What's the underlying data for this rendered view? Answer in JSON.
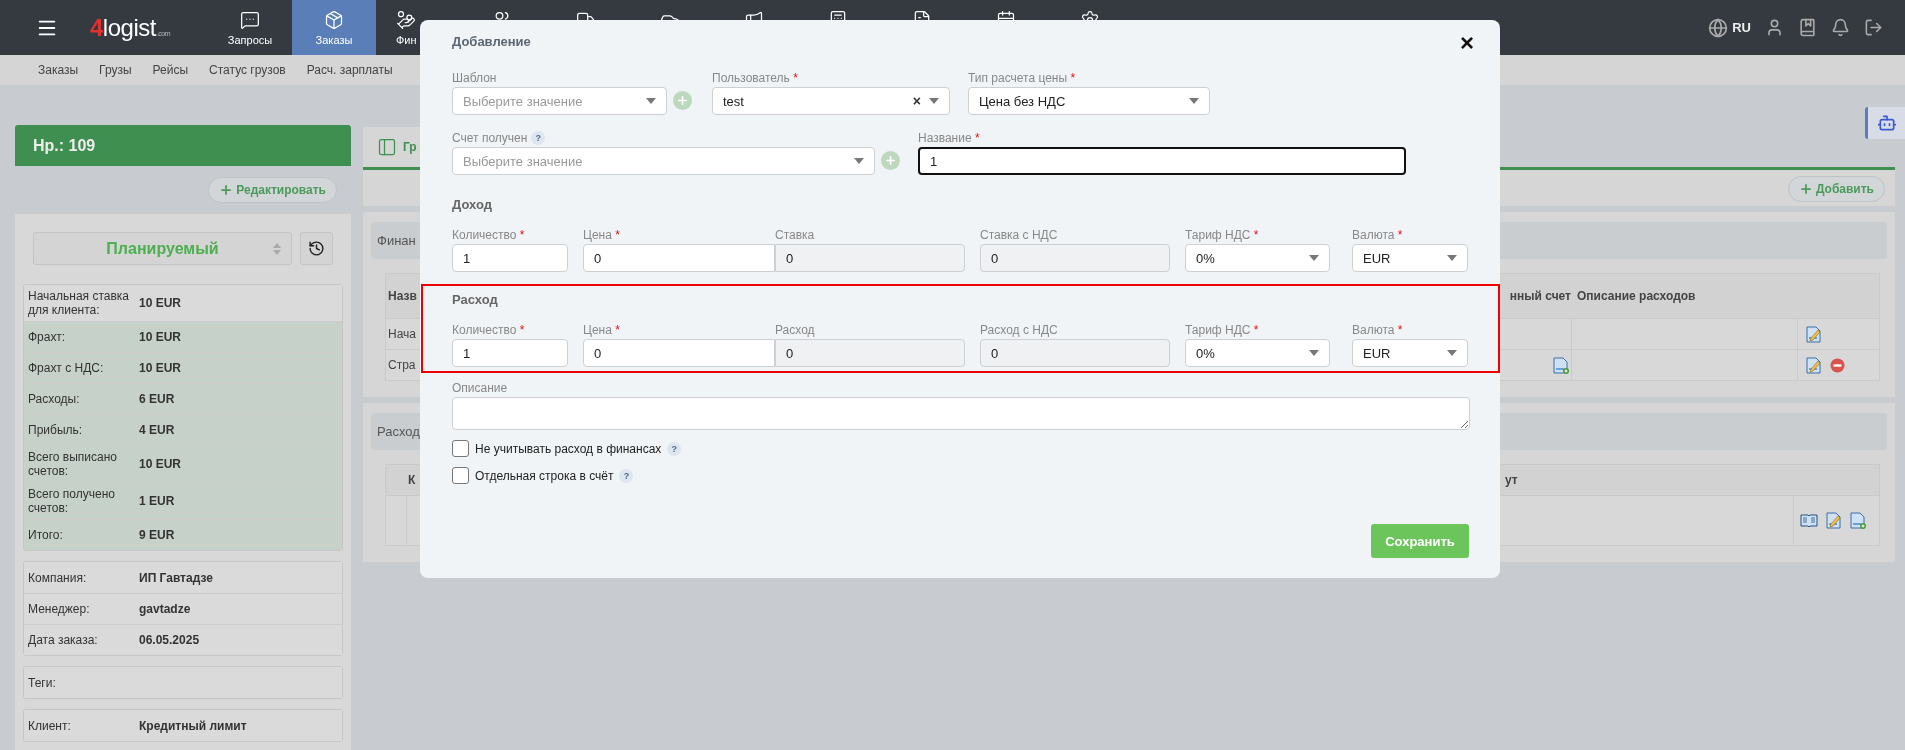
{
  "topbar": {
    "logo": {
      "mark": "4",
      "name": "logist",
      "domain": ".com"
    },
    "nav": [
      {
        "label": "Запросы",
        "selected": false
      },
      {
        "label": "Заказы",
        "selected": true
      },
      {
        "label": "Фин",
        "selected": false
      }
    ],
    "language": "RU"
  },
  "subnav": [
    "Заказы",
    "Грузы",
    "Рейсы",
    "Статус грузов",
    "Расч. зарплаты"
  ],
  "order": {
    "title": "Нр.: 109",
    "edit_button": "Редактировать",
    "status": "Планируемый",
    "summary": [
      {
        "label": "Начальная ставка для клиента:",
        "value": "10 EUR",
        "highlighted": false
      },
      {
        "label": "Фрахт:",
        "value": "10 EUR",
        "highlighted": true
      },
      {
        "label": "Фрахт с НДС:",
        "value": "10 EUR",
        "highlighted": true
      },
      {
        "label": "Расходы:",
        "value": "6 EUR",
        "highlighted": true
      },
      {
        "label": "Прибыль:",
        "value": "4 EUR",
        "highlighted": true
      },
      {
        "label": "Всего выписано счетов:",
        "value": "10 EUR",
        "highlighted": true
      },
      {
        "label": "Всего получено счетов:",
        "value": "1 EUR",
        "highlighted": true
      },
      {
        "label": "Итого:",
        "value": "9 EUR",
        "highlighted": true
      }
    ],
    "details": [
      {
        "label": "Компания:",
        "value": "ИП Гавтадзе"
      },
      {
        "label": "Менеджер:",
        "value": "gavtadze"
      },
      {
        "label": "Дата заказа:",
        "value": "06.05.2025"
      }
    ],
    "tags": {
      "label": "Теги:"
    },
    "client": {
      "label": "Клиент:",
      "value": "Кредитный лимит"
    }
  },
  "main": {
    "tab_label": "Гр",
    "add_button": "Добавить",
    "finance": {
      "title": "Финан",
      "columns": [
        "Назв",
        "нный счет",
        "Описание расходов"
      ],
      "rows": [
        {
          "name": "Нача",
          "has_document": false,
          "removable": false
        },
        {
          "name": "Стра",
          "has_document": true,
          "removable": true
        }
      ]
    },
    "expenses": {
      "title": "Расход",
      "columns": [
        "К",
        "ут"
      ]
    }
  },
  "modal": {
    "title": "Добавление",
    "close": "×",
    "required_mark": "*",
    "help_mark": "?",
    "row1": [
      {
        "label": "Шаблон",
        "required": false,
        "kind": "select",
        "placeholder": "Выберите значение",
        "addable": true
      },
      {
        "label": "Пользователь",
        "required": true,
        "kind": "clearable",
        "value": "test",
        "clear": "×"
      },
      {
        "label": "Тип расчета цены",
        "required": true,
        "kind": "select",
        "value": "Цена без НДС"
      }
    ],
    "row2": [
      {
        "label": "Счет получен",
        "required": false,
        "help": true,
        "kind": "select",
        "placeholder": "Выберите значение",
        "addable": true
      },
      {
        "label": "Название",
        "required": true,
        "kind": "text",
        "value": "1",
        "focused": true
      }
    ],
    "income": {
      "title": "Доход",
      "highlighted": false,
      "fields": [
        {
          "label": "Количество",
          "required": true,
          "kind": "text",
          "value": "1"
        },
        {
          "label": "Цена",
          "required": true,
          "kind": "text",
          "value": "0"
        },
        {
          "label": "Ставка",
          "required": false,
          "kind": "readonly",
          "value": "0"
        },
        {
          "label": "Ставка с НДС",
          "required": false,
          "kind": "readonly",
          "value": "0"
        },
        {
          "label": "Тариф НДС",
          "required": true,
          "kind": "select",
          "value": "0%"
        },
        {
          "label": "Валюта",
          "required": true,
          "kind": "select",
          "value": "EUR"
        }
      ]
    },
    "expense": {
      "title": "Расход",
      "highlighted": true,
      "fields": [
        {
          "label": "Количество",
          "required": true,
          "kind": "text",
          "value": "1"
        },
        {
          "label": "Цена",
          "required": true,
          "kind": "text",
          "value": "0"
        },
        {
          "label": "Расход",
          "required": false,
          "kind": "readonly",
          "value": "0"
        },
        {
          "label": "Расход с НДС",
          "required": false,
          "kind": "readonly",
          "value": "0"
        },
        {
          "label": "Тариф НДС",
          "required": true,
          "kind": "select",
          "value": "0%"
        },
        {
          "label": "Валюта",
          "required": true,
          "kind": "select",
          "value": "EUR"
        }
      ]
    },
    "description": {
      "label": "Описание"
    },
    "checkboxes": [
      {
        "label": "Не учитывать расход в финансах",
        "checked": false
      },
      {
        "label": "Отдельная строка в счёт",
        "checked": false
      }
    ],
    "save_button": "Сохранить"
  }
}
